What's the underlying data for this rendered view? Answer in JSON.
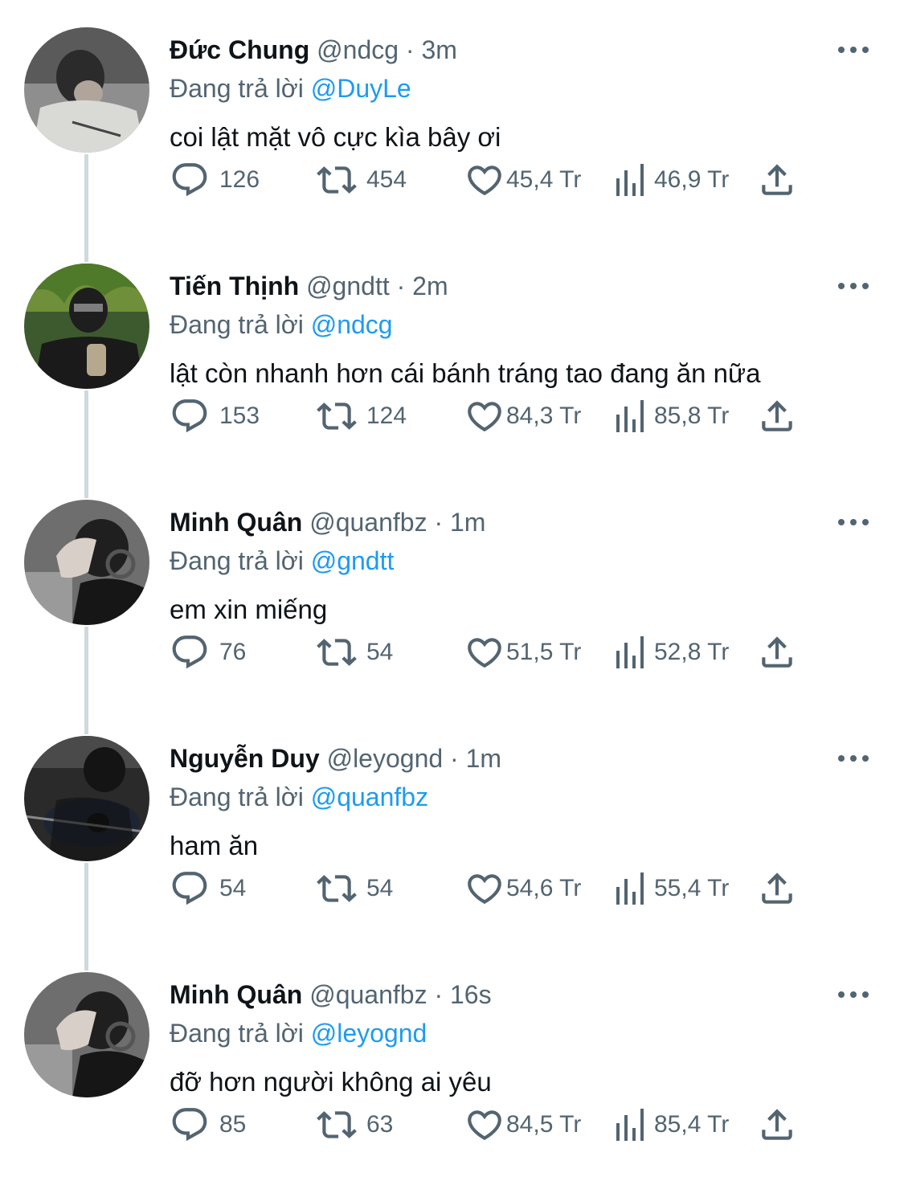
{
  "reply_prefix": "Đang trả lời",
  "colors": {
    "text": "#0f1419",
    "secondary": "#536471",
    "mention": "#1d9bf0",
    "thread_line": "#cfd9de",
    "background": "#ffffff"
  },
  "tweets": [
    {
      "name": "Đức Chung",
      "handle": "@ndcg",
      "separator": "·",
      "time": "3m",
      "reply_to": "@DuyLe",
      "text": "coi lật mặt vô cực kìa bây ơi",
      "replies": "126",
      "retweets": "454",
      "likes": "45,4 Tr",
      "views": "46,9 Tr",
      "avatar_icon": "user-avatar-photo"
    },
    {
      "name": "Tiến Thịnh",
      "handle": "@gndtt",
      "separator": "·",
      "time": "2m",
      "reply_to": "@ndcg",
      "text": "lật còn nhanh hơn cái bánh tráng tao đang ăn nữa",
      "replies": "153",
      "retweets": "124",
      "likes": "84,3 Tr",
      "views": "85,8 Tr",
      "avatar_icon": "user-avatar-photo"
    },
    {
      "name": "Minh Quân",
      "handle": "@quanfbz",
      "separator": "·",
      "time": "1m",
      "reply_to": "@gndtt",
      "text": "em xin miếng",
      "replies": "76",
      "retweets": "54",
      "likes": "51,5 Tr",
      "views": "52,8 Tr",
      "avatar_icon": "user-avatar-photo"
    },
    {
      "name": "Nguyễn Duy",
      "handle": "@leyognd",
      "separator": "·",
      "time": "1m",
      "reply_to": "@quanfbz",
      "text": "ham ăn",
      "replies": "54",
      "retweets": "54",
      "likes": "54,6 Tr",
      "views": "55,4 Tr",
      "avatar_icon": "user-avatar-photo"
    },
    {
      "name": "Minh Quân",
      "handle": "@quanfbz",
      "separator": "·",
      "time": "16s",
      "reply_to": "@leyognd",
      "text": "đỡ hơn người không ai yêu",
      "replies": "85",
      "retweets": "63",
      "likes": "84,5 Tr",
      "views": "85,4 Tr",
      "avatar_icon": "user-avatar-photo"
    }
  ]
}
